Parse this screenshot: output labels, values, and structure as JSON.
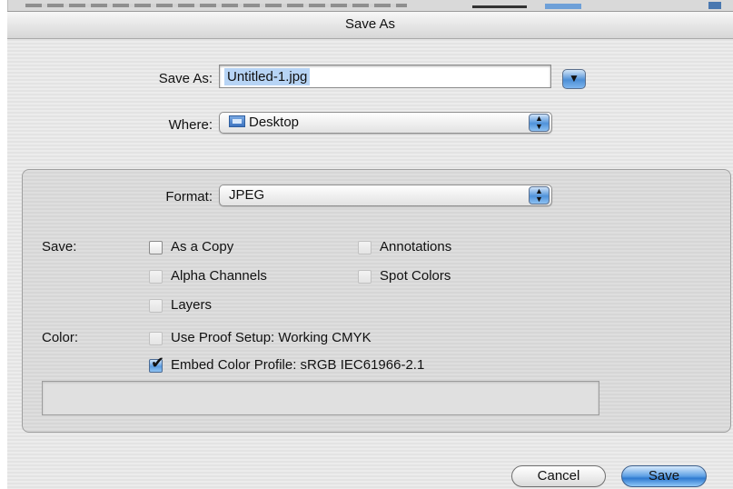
{
  "dialog": {
    "title": "Save As"
  },
  "save_as": {
    "label": "Save As:",
    "value": "Untitled-1.jpg",
    "expand_icon": "disclosure-triangle-down"
  },
  "where": {
    "label": "Where:",
    "value": "Desktop",
    "icon": "desktop-folder"
  },
  "format": {
    "label": "Format:",
    "value": "JPEG"
  },
  "save_options": {
    "label": "Save:",
    "items": [
      {
        "label": "As a Copy",
        "checked": false,
        "enabled": true
      },
      {
        "label": "Annotations",
        "checked": false,
        "enabled": false
      },
      {
        "label": "Alpha Channels",
        "checked": false,
        "enabled": false
      },
      {
        "label": "Spot Colors",
        "checked": false,
        "enabled": false
      },
      {
        "label": "Layers",
        "checked": false,
        "enabled": false
      }
    ]
  },
  "color_options": {
    "label": "Color:",
    "items": [
      {
        "label": "Use Proof Setup:  Working CMYK",
        "checked": false,
        "enabled": false
      },
      {
        "label": "Embed Color Profile:  sRGB IEC61966-2.1",
        "checked": true,
        "enabled": true
      }
    ]
  },
  "buttons": {
    "cancel": "Cancel",
    "save": "Save"
  },
  "colors": {
    "accent_blue": "#4f92da",
    "selection": "#b7d4f5"
  }
}
